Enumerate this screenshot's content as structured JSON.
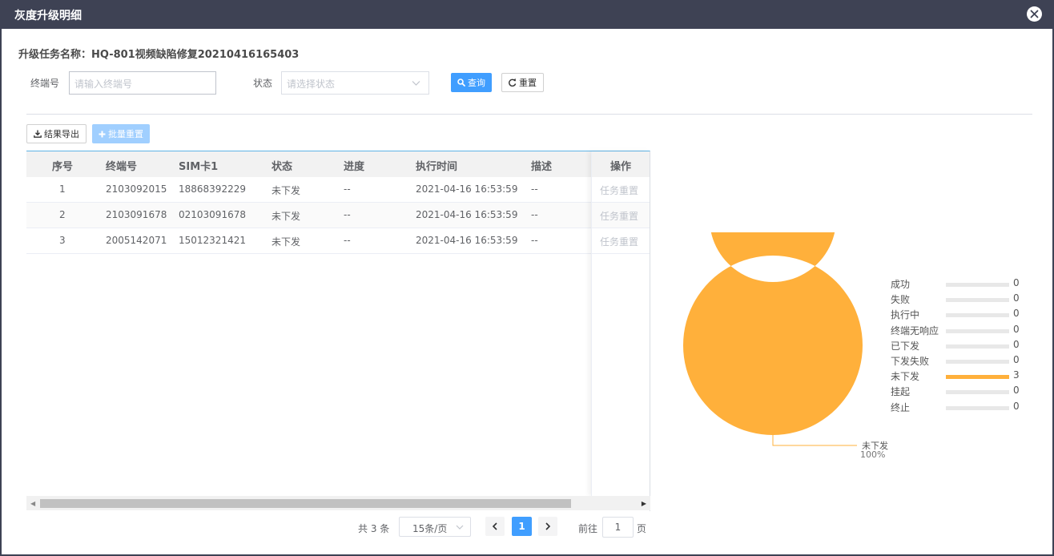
{
  "dialog": {
    "title": "灰度升级明细",
    "task_label": "升级任务名称：",
    "task_name": "HQ-801视频缺陷修复20210416165403"
  },
  "filters": {
    "terminal_label": "终端号",
    "terminal_placeholder": "请输入终端号",
    "status_label": "状态",
    "status_placeholder": "请选择状态",
    "search_label": "查询",
    "reset_label": "重置"
  },
  "toolbar": {
    "export_label": "结果导出",
    "batch_reset_label": "批量重置"
  },
  "table": {
    "columns": [
      "序号",
      "终端号",
      "SIM卡1",
      "状态",
      "进度",
      "执行时间",
      "描述",
      "操作"
    ],
    "rows": [
      {
        "index": "1",
        "terminal": "2103092015",
        "sim": "18868392229",
        "status": "未下发",
        "progress": "--",
        "time": "2021-04-16 16:53:59",
        "desc": "--",
        "action": "任务重置"
      },
      {
        "index": "2",
        "terminal": "2103091678",
        "sim": "02103091678",
        "status": "未下发",
        "progress": "--",
        "time": "2021-04-16 16:53:59",
        "desc": "--",
        "action": "任务重置"
      },
      {
        "index": "3",
        "terminal": "2005142071",
        "sim": "15012321421",
        "status": "未下发",
        "progress": "--",
        "time": "2021-04-16 16:53:59",
        "desc": "--",
        "action": "任务重置"
      }
    ]
  },
  "pagination": {
    "total": "共 3 条",
    "page_size": "15条/页",
    "current_page": "1",
    "goto_label": "前往",
    "goto_value": "1",
    "page_suffix": "页"
  },
  "chart_data": {
    "type": "pie",
    "donut": true,
    "categories": [
      "成功",
      "失败",
      "执行中",
      "终端无响应",
      "已下发",
      "下发失败",
      "未下发",
      "挂起",
      "终止"
    ],
    "values": [
      0,
      0,
      0,
      0,
      0,
      0,
      3,
      0,
      0
    ],
    "colors": {
      "active": "#ffb03b",
      "track": "#e8e8e8"
    },
    "slice_label": {
      "name": "未下发",
      "percent": "100%"
    },
    "legend_position": "right"
  }
}
